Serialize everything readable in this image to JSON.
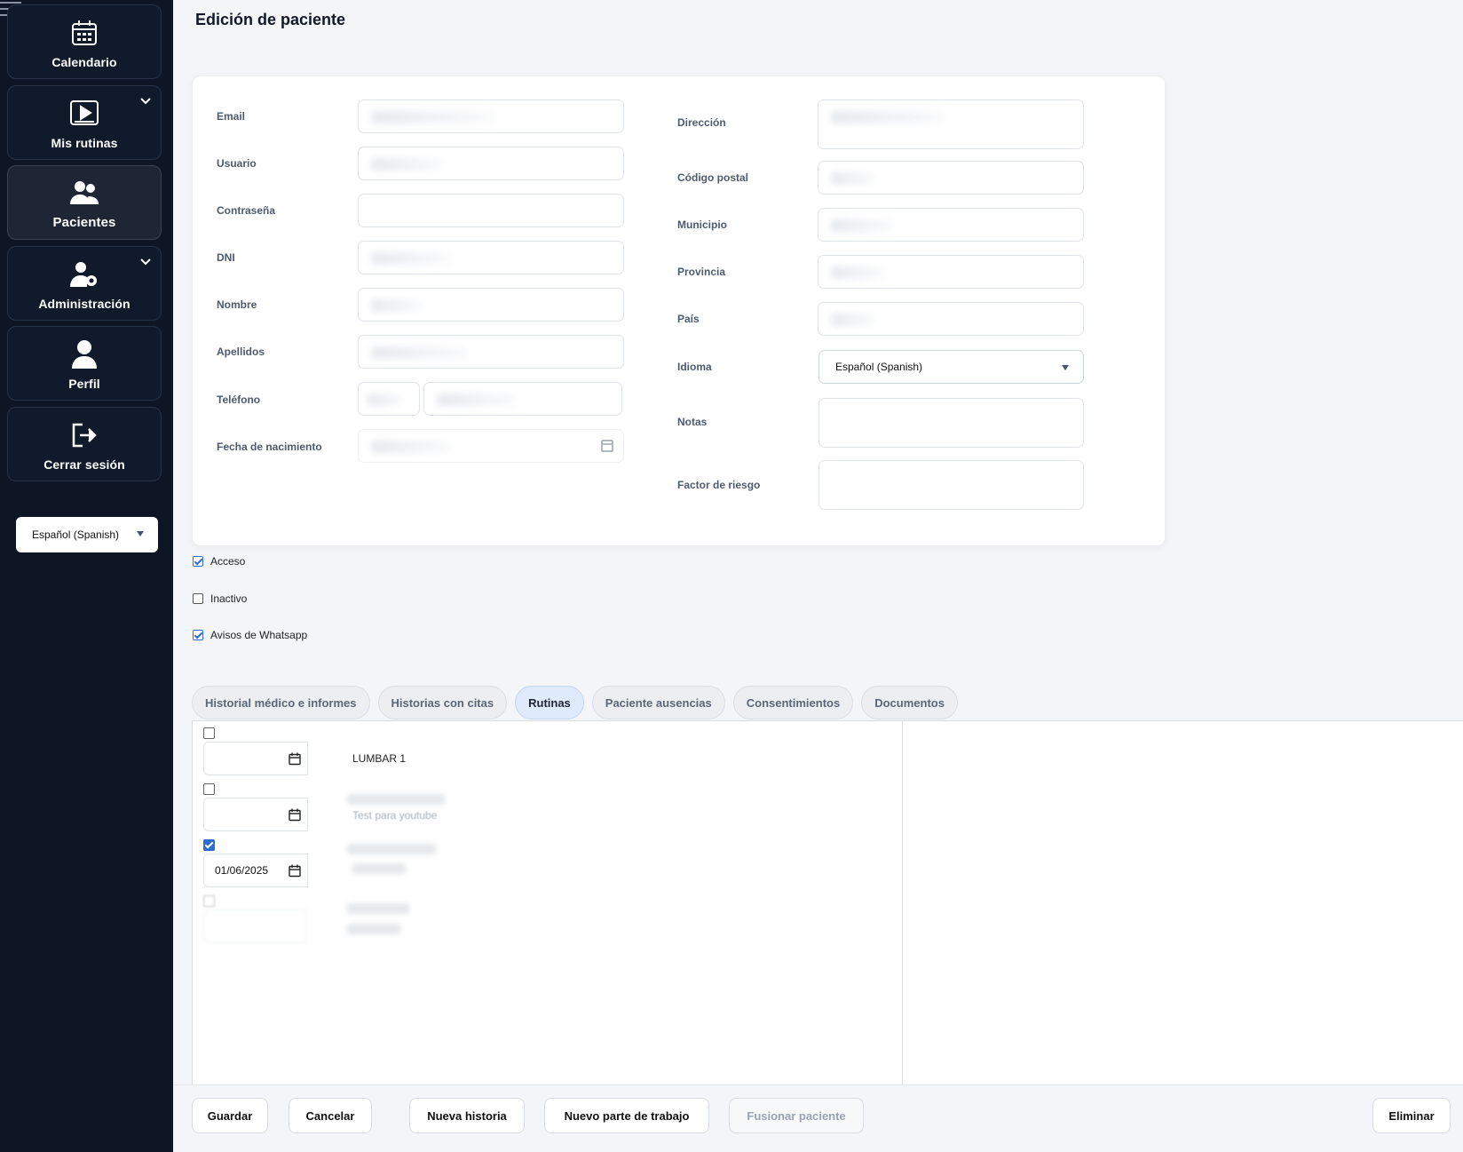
{
  "sidebar": {
    "items": [
      {
        "label": "Calendario",
        "icon": "calendar-icon"
      },
      {
        "label": "Mis rutinas",
        "icon": "video-play-icon"
      },
      {
        "label": "Pacientes",
        "icon": "users-icon"
      },
      {
        "label": "Administración",
        "icon": "user-gear-icon"
      },
      {
        "label": "Perfil",
        "icon": "user-icon"
      },
      {
        "label": "Cerrar sesión",
        "icon": "logout-icon"
      }
    ],
    "language": "Español (Spanish)"
  },
  "page": {
    "title": "Edición de paciente"
  },
  "form": {
    "left": {
      "email": "Email",
      "usuario": "Usuario",
      "password": "Contraseña",
      "dni": "DNI",
      "nombre": "Nombre",
      "apellidos": "Apellidos",
      "telefono": "Teléfono",
      "fecha": "Fecha de nacimiento"
    },
    "right": {
      "direccion": "Dirección",
      "cp": "Código postal",
      "municipio": "Municipio",
      "provincia": "Provincia",
      "pais": "País",
      "idioma": "Idioma",
      "idioma_value": "Español (Spanish)",
      "notas": "Notas",
      "factor": "Factor de riesgo"
    }
  },
  "checks": {
    "acceso": {
      "label": "Acceso",
      "checked": true
    },
    "inactivo": {
      "label": "Inactivo",
      "checked": false
    },
    "whatsapp": {
      "label": "Avisos de Whatsapp",
      "checked": true
    }
  },
  "tabs": [
    {
      "label": "Historial médico e informes",
      "active": false
    },
    {
      "label": "Historias con citas",
      "active": false
    },
    {
      "label": "Rutinas",
      "active": true
    },
    {
      "label": "Paciente ausencias",
      "active": false
    },
    {
      "label": "Consentimientos",
      "active": false
    },
    {
      "label": "Documentos",
      "active": false
    }
  ],
  "routines": [
    {
      "checked": false,
      "date": "",
      "name": "LUMBAR 1"
    },
    {
      "checked": false,
      "date": "",
      "name": "Test para youtube"
    },
    {
      "checked": true,
      "date": "01/06/2025",
      "name": ""
    },
    {
      "checked": false,
      "date": "",
      "name": ""
    }
  ],
  "footer": {
    "guardar": "Guardar",
    "cancelar": "Cancelar",
    "nueva_historia": "Nueva historia",
    "nuevo_parte": "Nuevo parte de trabajo",
    "fusionar": "Fusionar paciente",
    "eliminar": "Eliminar"
  }
}
